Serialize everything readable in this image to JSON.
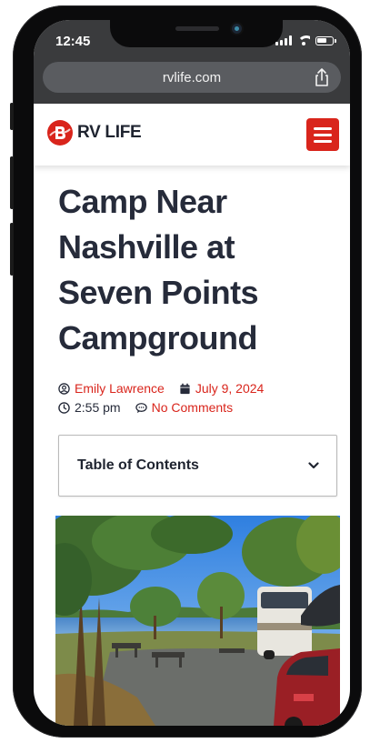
{
  "status_bar": {
    "time": "12:45"
  },
  "browser": {
    "url": "rvlife.com",
    "share_icon": "share-icon"
  },
  "header": {
    "logo_text": "RV LIFE",
    "logo_mark_letter": "B",
    "menu_icon": "hamburger-menu-icon",
    "accent_color": "#d9251c"
  },
  "article": {
    "title_lines": [
      "Camp Near",
      "Nashville at",
      "Seven Points",
      "Campground"
    ],
    "author": "Emily Lawrence",
    "date": "July 9, 2024",
    "time": "2:55 pm",
    "comments": "No Comments"
  },
  "toc": {
    "label": "Table of Contents"
  },
  "hero_image": {
    "description_icon": "campground-photo"
  }
}
